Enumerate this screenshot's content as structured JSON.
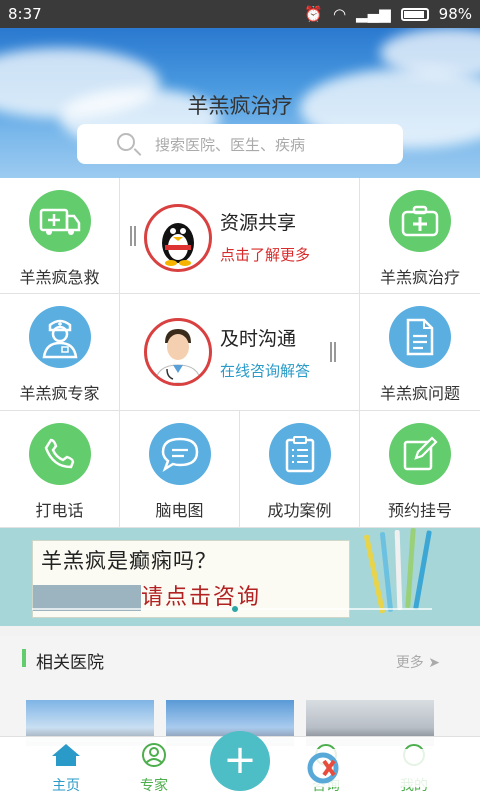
{
  "status_bar": {
    "time": "8:37",
    "battery": "98%"
  },
  "header": {
    "title": "羊羔疯治疗",
    "search_placeholder": "搜索医院、医生、疾病"
  },
  "grid": {
    "emergency": {
      "label": "羊羔疯急救",
      "icon": "ambulance-icon"
    },
    "resource": {
      "title": "资源共享",
      "subtitle": "点击了解更多",
      "subtitle_color": "#d92b2b",
      "icon": "penguin-avatar-icon"
    },
    "treatment": {
      "label": "羊羔疯治疗",
      "icon": "first-aid-kit-icon"
    },
    "expert": {
      "label": "羊羔疯专家",
      "icon": "nurse-icon"
    },
    "communicate": {
      "title": "及时沟通",
      "subtitle": "在线咨询解答",
      "subtitle_color": "#2a9bc8",
      "icon": "doctor-avatar-icon"
    },
    "questions": {
      "label": "羊羔疯问题",
      "icon": "document-icon"
    },
    "call": {
      "label": "打电话",
      "icon": "phone-icon"
    },
    "eeg": {
      "label": "脑电图",
      "icon": "chat-bubble-icon"
    },
    "cases": {
      "label": "成功案例",
      "icon": "clipboard-icon"
    },
    "appointment": {
      "label": "预约挂号",
      "icon": "edit-icon"
    }
  },
  "banner": {
    "line1": "羊羔疯是癫痫吗？",
    "line2": "请点击咨询"
  },
  "related": {
    "title": "相关医院",
    "more": "更多"
  },
  "nav": {
    "home": "主页",
    "expert": "专家",
    "consult": "咨询",
    "mine": "我的",
    "active_color": "#2a9bc8"
  },
  "watermark": {
    "text": "西西软件园",
    "domain": "CR173.com"
  }
}
